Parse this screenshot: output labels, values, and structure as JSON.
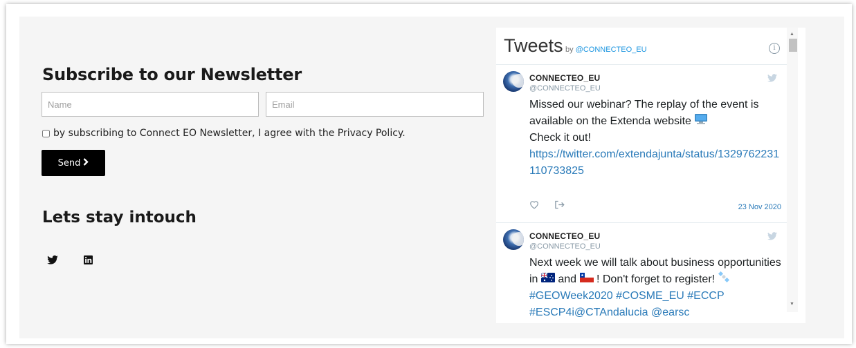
{
  "newsletter": {
    "title": "Subscribe to our Newsletter",
    "name_placeholder": "Name",
    "email_placeholder": "Email",
    "name_value": "",
    "email_value": "",
    "consent_label": "by subscribing to Connect EO Newsletter, I agree with the Privacy Policy.",
    "consent_checked": false,
    "send_label": "Send",
    "send_icon": "chevron-right-icon"
  },
  "social": {
    "title": "Lets stay intouch",
    "links": [
      {
        "icon": "twitter-icon"
      },
      {
        "icon": "linkedin-icon"
      }
    ]
  },
  "twitter_widget": {
    "title": "Tweets",
    "by_prefix": "by ",
    "by_handle": "@CONNECTEO_EU",
    "info_icon": "info-icon",
    "tweets": [
      {
        "name": "CONNECTEO_EU",
        "handle": "@CONNECTEO_EU",
        "text_line1": "Missed our webinar? The replay of the event is available on the Extenda website",
        "text_line2": "Check it out!",
        "link": "https://twitter.com/extendajunta/status/1329762231110733825",
        "date": "23 Nov 2020"
      },
      {
        "name": "CONNECTEO_EU",
        "handle": "@CONNECTEO_EU",
        "text_part1": "Next week we will talk about business opportunities in",
        "text_part2": "and",
        "text_part3": "! Don't forget to register!",
        "hashtags": "#GEOWeek2020 #COSME_EU",
        "text_overflow": "#ECCP #ESCP4i@CTAndalucia @earsc"
      }
    ]
  },
  "colors": {
    "panel_bg": "#f5f5f5",
    "button_bg": "#000000",
    "link": "#2b7bb9"
  }
}
